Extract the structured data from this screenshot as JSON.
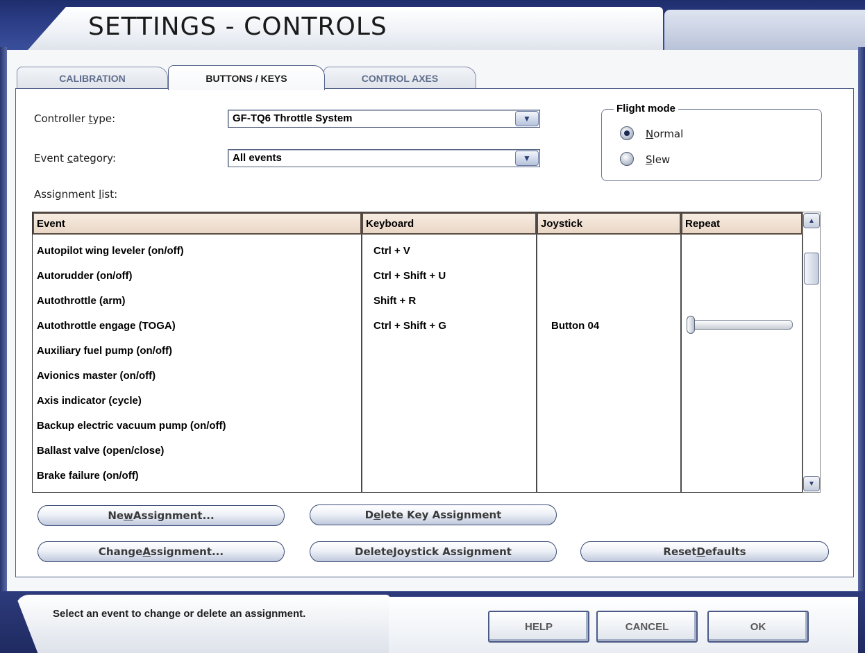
{
  "window": {
    "title": "SETTINGS - CONTROLS"
  },
  "tabs": [
    {
      "label": "CALIBRATION"
    },
    {
      "label": "BUTTONS / KEYS"
    },
    {
      "label": "CONTROL AXES"
    }
  ],
  "controller_type": {
    "label_pre": "Controller ",
    "label_key": "t",
    "label_post": "ype:",
    "value": "GF-TQ6 Throttle System"
  },
  "event_category": {
    "label_pre": "Event ",
    "label_key": "c",
    "label_post": "ategory:",
    "value": "All events"
  },
  "assignment_list": {
    "label_pre": "Assignment ",
    "label_key": "l",
    "label_post": "ist:"
  },
  "flight_mode": {
    "legend": "Flight mode",
    "options": [
      {
        "key": "N",
        "rest": "ormal",
        "selected": true
      },
      {
        "key": "S",
        "rest": "lew",
        "selected": false
      }
    ]
  },
  "table": {
    "headers": [
      "Event",
      "Keyboard",
      "Joystick",
      "Repeat"
    ],
    "rows": [
      {
        "event": "Autopilot wing leveler (on/off)",
        "keyboard": "Ctrl + V",
        "joystick": ""
      },
      {
        "event": "Autorudder (on/off)",
        "keyboard": "Ctrl + Shift + U",
        "joystick": ""
      },
      {
        "event": "Autothrottle (arm)",
        "keyboard": "Shift + R",
        "joystick": ""
      },
      {
        "event": "Autothrottle engage (TOGA)",
        "keyboard": "Ctrl + Shift + G",
        "joystick": "Button 04"
      },
      {
        "event": "Auxiliary fuel pump (on/off)",
        "keyboard": "",
        "joystick": ""
      },
      {
        "event": "Avionics master (on/off)",
        "keyboard": "",
        "joystick": ""
      },
      {
        "event": "Axis indicator (cycle)",
        "keyboard": "",
        "joystick": ""
      },
      {
        "event": "Backup electric vacuum pump (on/off)",
        "keyboard": "",
        "joystick": ""
      },
      {
        "event": "Ballast valve (open/close)",
        "keyboard": "",
        "joystick": ""
      },
      {
        "event": "Brake failure (on/off)",
        "keyboard": "",
        "joystick": ""
      }
    ],
    "repeat_slider_level": 0
  },
  "buttons": {
    "new_assignment": {
      "pre": "Ne",
      "key": "w",
      "post": " Assignment..."
    },
    "change_assignment": {
      "pre": "Change ",
      "key": "A",
      "post": "ssignment..."
    },
    "delete_key_assignment": {
      "pre": "D",
      "key": "e",
      "post": "lete Key Assignment"
    },
    "delete_joystick_assignment": {
      "pre": "Delete ",
      "key": "J",
      "post": "oystick Assignment"
    },
    "reset_defaults": {
      "pre": "Reset ",
      "key": "D",
      "post": "efaults"
    }
  },
  "status": {
    "message": "Select an event to change or delete an assignment."
  },
  "dialog_buttons": {
    "help": "HELP",
    "cancel": "CANCEL",
    "ok": "OK"
  },
  "icons": {
    "combo_arrow": "chevron-down-icon",
    "scroll_up": "arrow-up-icon",
    "scroll_down": "arrow-down-icon"
  }
}
